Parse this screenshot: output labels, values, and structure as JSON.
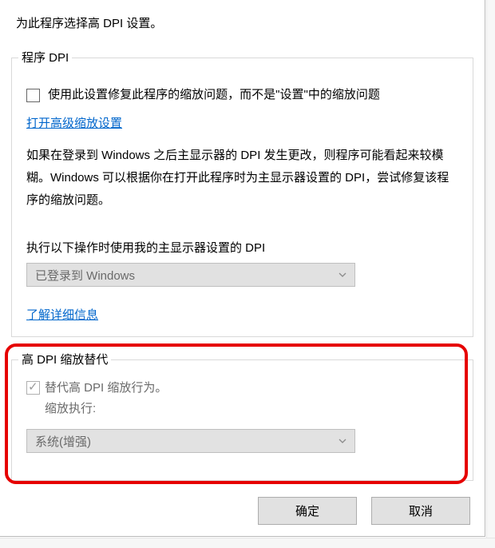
{
  "intro": "为此程序选择高 DPI 设置。",
  "group1": {
    "title": "程序 DPI",
    "checkbox_label": "使用此设置修复此程序的缩放问题，而不是\"设置\"中的缩放问题",
    "link_advanced": "打开高级缩放设置",
    "explanation": "如果在登录到 Windows 之后主显示器的 DPI 发生更改，则程序可能看起来较模糊。Windows 可以根据你在打开此程序时为主显示器设置的 DPI，尝试修复该程序的缩放问题。",
    "when_label": "执行以下操作时使用我的主显示器设置的 DPI",
    "when_dropdown": "已登录到 Windows",
    "link_more": "了解详细信息"
  },
  "group2": {
    "title": "高 DPI 缩放替代",
    "checkbox_line1": "替代高 DPI 缩放行为。",
    "checkbox_line2": "缩放执行:",
    "dropdown": "系统(增强)"
  },
  "buttons": {
    "ok": "确定",
    "cancel": "取消"
  }
}
